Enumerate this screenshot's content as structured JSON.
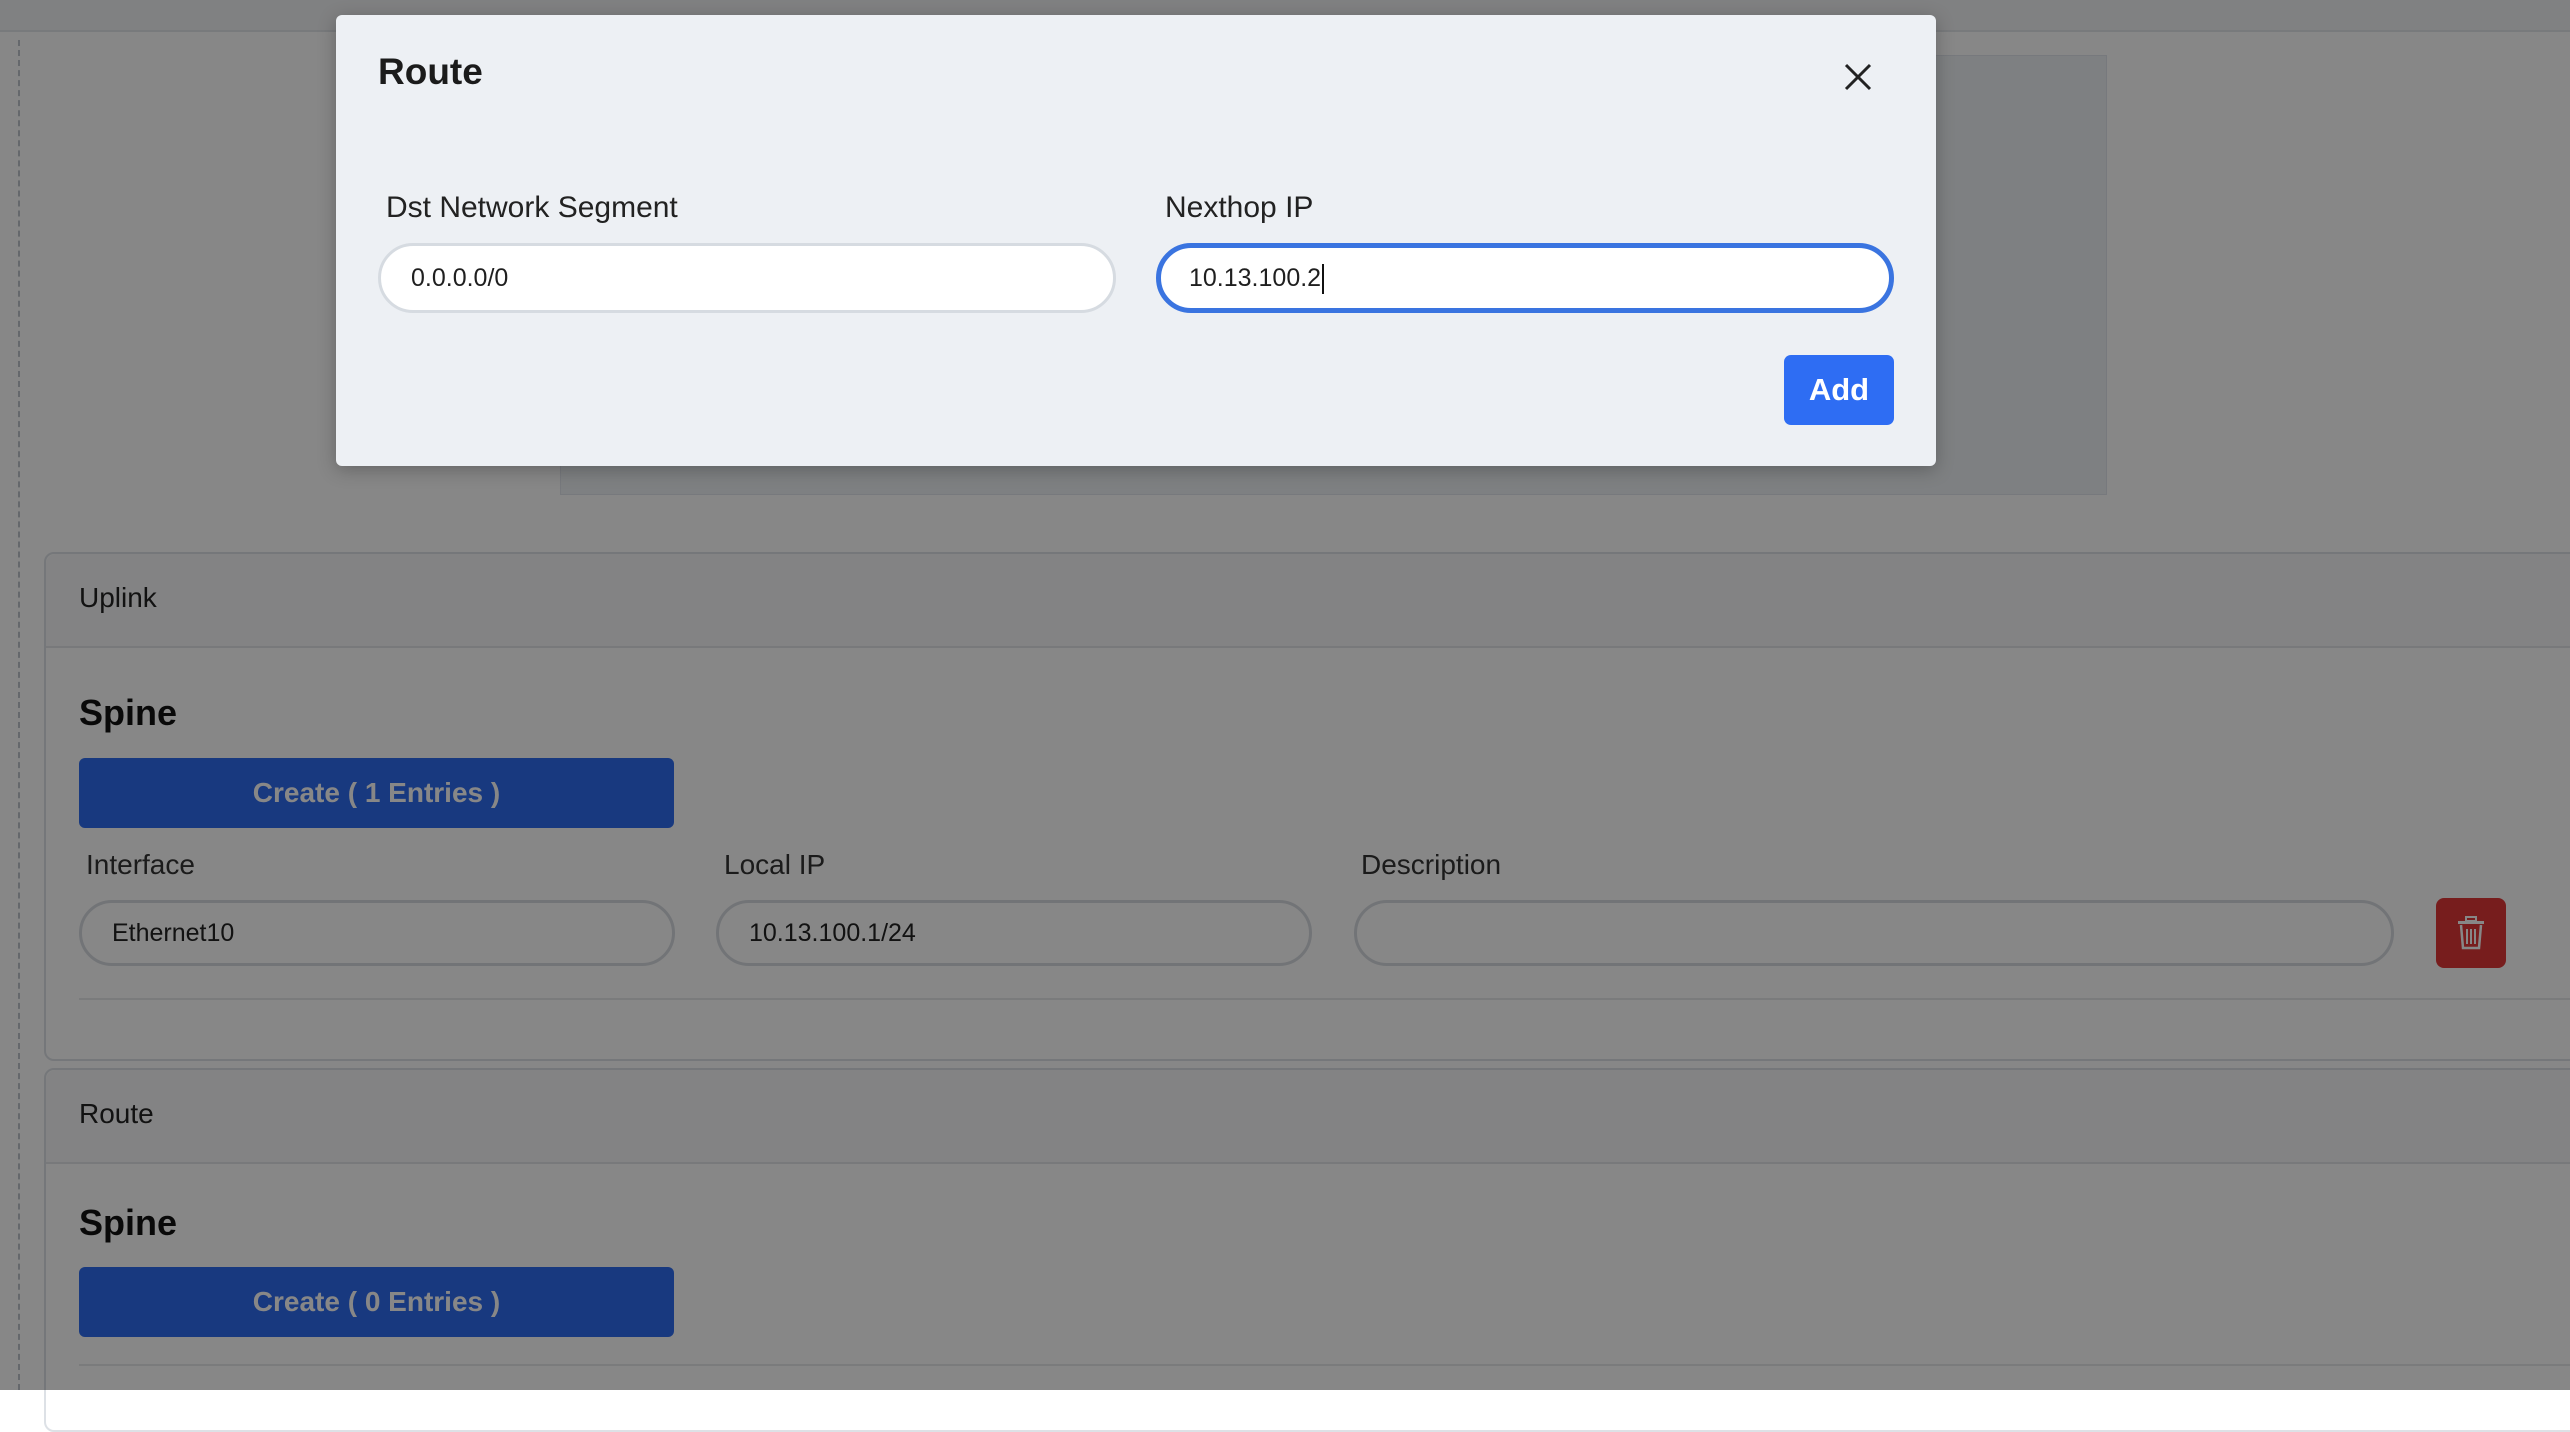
{
  "modal": {
    "title": "Route",
    "close_icon": "close-icon",
    "dst_label": "Dst Network Segment",
    "dst_value": "0.0.0.0/0",
    "nexthop_label": "Nexthop IP",
    "nexthop_value": "10.13.100.2",
    "add_label": "Add"
  },
  "uplink": {
    "title": "Uplink",
    "group": "Spine",
    "create_label": "Create ( 1 Entries )",
    "columns": {
      "interface": "Interface",
      "local_ip": "Local IP",
      "description": "Description"
    },
    "rows": [
      {
        "interface": "Ethernet10",
        "local_ip": "10.13.100.1/24",
        "description": ""
      }
    ],
    "delete_icon": "trash-icon"
  },
  "route": {
    "title": "Route",
    "group": "Spine",
    "create_label": "Create ( 0 Entries )"
  },
  "colors": {
    "primary": "#2f6cf0",
    "danger": "#e03838",
    "focus_border": "#3a74e0"
  }
}
